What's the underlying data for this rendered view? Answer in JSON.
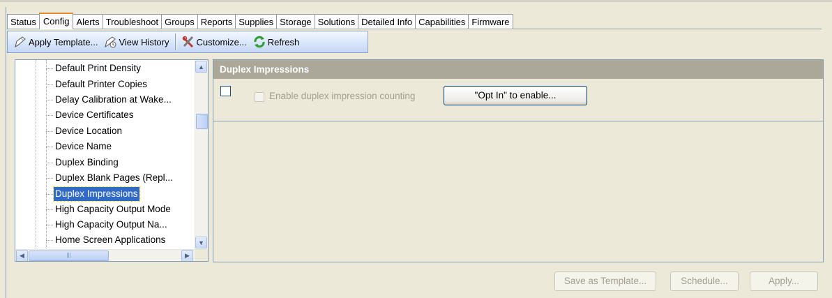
{
  "tabs": [
    "Status",
    "Config",
    "Alerts",
    "Troubleshoot",
    "Groups",
    "Reports",
    "Supplies",
    "Storage",
    "Solutions",
    "Detailed Info",
    "Capabilities",
    "Firmware"
  ],
  "active_tab": "Config",
  "toolbar": {
    "apply_template": "Apply Template...",
    "view_history": "View History",
    "customize": "Customize...",
    "refresh": "Refresh"
  },
  "tree": {
    "items": [
      "Default Print Density",
      "Default Printer Copies",
      "Delay Calibration at Wake...",
      "Device Certificates",
      "Device Location",
      "Device Name",
      "Duplex Binding",
      "Duplex Blank Pages (Repl...",
      "Duplex Impressions",
      "High Capacity Output Mode",
      "High Capacity Output Na...",
      "Home Screen Applications"
    ],
    "selected": "Duplex Impressions"
  },
  "panel": {
    "title": "Duplex Impressions",
    "checkbox_label": "Enable duplex impression counting",
    "optin_button": "\"Opt In\" to enable..."
  },
  "footer": {
    "save_template": "Save as Template...",
    "schedule": "Schedule...",
    "apply": "Apply..."
  },
  "colors": {
    "panel_header": "#aca899",
    "selection": "#316ac5",
    "active_tab_accent": "#e68b2c"
  }
}
